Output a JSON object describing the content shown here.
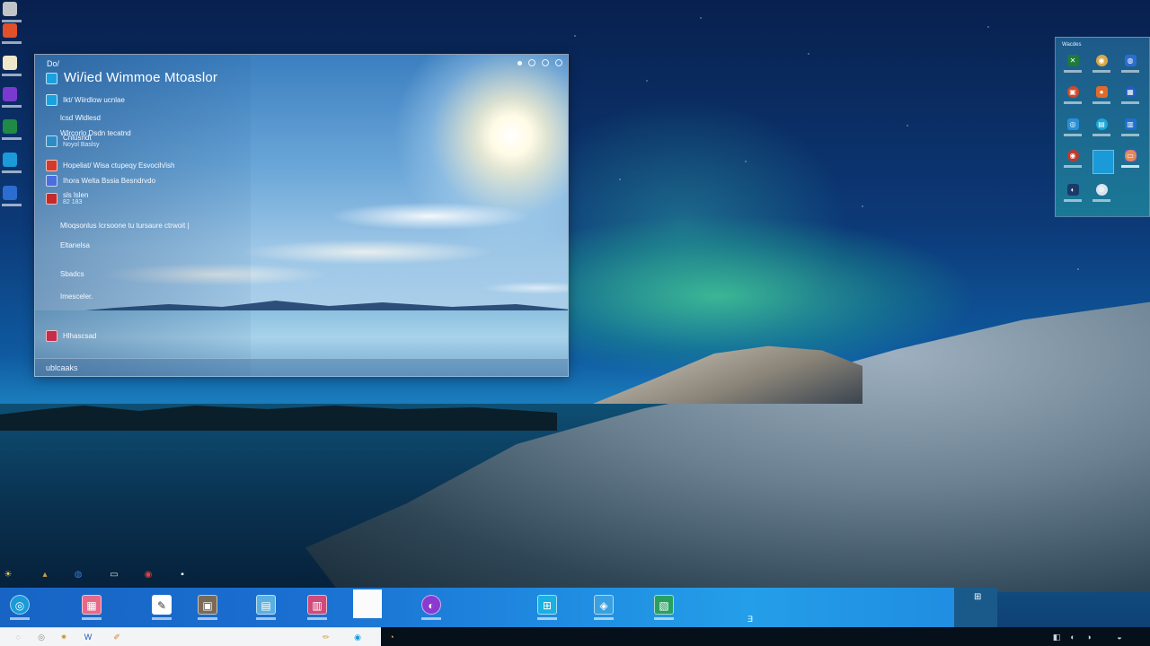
{
  "main_window": {
    "app_label": "Do/",
    "title": "Wi/ied Wimmoe Mtoaslor",
    "rows": [
      {
        "text": "Ikt/ Wiirdlow ucnlae",
        "sub": "",
        "icon": "app-icon",
        "color": "#1aa1e0"
      },
      {
        "text": "lcsd Wldlesd",
        "sub": "",
        "icon": "",
        "color": ""
      },
      {
        "text": "Wlrcorlo Dsdn tecatnd",
        "sub": "",
        "icon": "",
        "color": ""
      },
      {
        "text": "Cnlusndt",
        "sub": "Noyol Baslsy",
        "icon": "app-icon",
        "color": "#2b8cc7"
      },
      {
        "text": "Hopeliat/ Wisa ctupeqy Esvocih/ish",
        "sub": "",
        "icon": "",
        "color": "#d23b2b"
      },
      {
        "text": "Ihora Welta Bssia Besndrvdo",
        "sub": "",
        "icon": "",
        "color": "#4a6de0"
      },
      {
        "text": "sls lslen",
        "sub": "82 183",
        "icon": "",
        "color": "#c42a2a"
      },
      {
        "text": "Mloqsonlus Icrsoone tu tursaure ctrwoit |",
        "sub": "",
        "icon": "",
        "color": ""
      },
      {
        "text": "Eltanelsa",
        "sub": "",
        "icon": "",
        "color": ""
      },
      {
        "text": "Sbadcs",
        "sub": "",
        "icon": "",
        "color": ""
      },
      {
        "text": "Imesceler.",
        "sub": "",
        "icon": "",
        "color": ""
      },
      {
        "text": "Hlhascsad",
        "sub": "",
        "icon": "",
        "color": "#c72c48"
      }
    ],
    "status": "ublcaaks"
  },
  "tile_panel": {
    "title": "Wacdes",
    "tiles": [
      {
        "name": "xbox-icon",
        "color": "#1f7a3a",
        "glyph": "✕"
      },
      {
        "name": "photos-icon",
        "color": "#d9a84a",
        "glyph": "◉"
      },
      {
        "name": "globe-icon",
        "color": "#2b6dd0",
        "glyph": "◍"
      },
      {
        "name": "office-icon",
        "color": "#d04a2a",
        "glyph": "▣"
      },
      {
        "name": "orange-app-icon",
        "color": "#e06a2a",
        "glyph": "●"
      },
      {
        "name": "blue-app-icon",
        "color": "#1e5fc0",
        "glyph": "▦"
      },
      {
        "name": "edge-icon",
        "color": "#2a8fd8",
        "glyph": "◎"
      },
      {
        "name": "store-icon",
        "color": "#1aa7d8",
        "glyph": "▤"
      },
      {
        "name": "book-icon",
        "color": "#1f6fd0",
        "glyph": "▥"
      },
      {
        "name": "chrome-icon",
        "color": "#c0392b",
        "glyph": "◉"
      },
      {
        "name": "purple-app-icon",
        "color": "#8a4ed8",
        "glyph": "⊡"
      },
      {
        "name": "folder-icon",
        "color": "#e08a5a",
        "glyph": "▭"
      },
      {
        "name": "steam-icon",
        "color": "#1a3a6a",
        "glyph": "◐"
      },
      {
        "name": "settings-icon",
        "color": "#d8e4ee",
        "glyph": "⚙"
      }
    ]
  },
  "taskbar": {
    "items": [
      {
        "name": "start-icon",
        "color": "#1a9ad8",
        "glyph": "◎"
      },
      {
        "name": "gallery-icon",
        "color": "#e56a8a",
        "glyph": "▦"
      },
      {
        "name": "pen-icon",
        "color": "#ffffff",
        "glyph": "✎"
      },
      {
        "name": "photo-app-icon",
        "color": "#7a6a5a",
        "glyph": "▣"
      },
      {
        "name": "mail-icon",
        "color": "#5ab0e0",
        "glyph": "▤"
      },
      {
        "name": "calendar-icon",
        "color": "#d04a7a",
        "glyph": "▥"
      },
      {
        "name": "onenote-icon",
        "color": "#8a3ad0",
        "glyph": "◐"
      },
      {
        "name": "windows-icon",
        "color": "#1ab0e0",
        "glyph": "⊞"
      },
      {
        "name": "security-icon",
        "color": "#3aa0e0",
        "glyph": "◈"
      },
      {
        "name": "store-taskbar-icon",
        "color": "#2aa060",
        "glyph": "▧"
      }
    ],
    "tray_text": "Ǝ",
    "tray_right": "⊞"
  },
  "bottom_strip": {
    "icons": [
      {
        "name": "circle-icon",
        "glyph": "◌",
        "color": "#888888"
      },
      {
        "name": "target-icon",
        "glyph": "◎",
        "color": "#888888"
      },
      {
        "name": "gear-icon",
        "glyph": "✷",
        "color": "#c09030"
      },
      {
        "name": "word-icon",
        "glyph": "W",
        "color": "#1a5fc0"
      },
      {
        "name": "brush-icon",
        "glyph": "✐",
        "color": "#d08030"
      },
      {
        "name": "pencil-icon",
        "glyph": "✏",
        "color": "#d0a040"
      },
      {
        "name": "skype-icon",
        "glyph": "◉",
        "color": "#1a9ad8"
      },
      {
        "name": "clock-icon",
        "glyph": "◔",
        "color": "#e0b060"
      }
    ],
    "tray": [
      {
        "name": "network-icon",
        "glyph": "◧"
      },
      {
        "name": "volume-icon",
        "glyph": "◐"
      },
      {
        "name": "battery-icon",
        "glyph": "◑"
      },
      {
        "name": "notification-icon",
        "glyph": "◒"
      }
    ]
  },
  "desktop": {
    "left_icons": [
      {
        "name": "recycle-icon",
        "color": "#c0c4c8"
      },
      {
        "name": "office-desktop-icon",
        "color": "#e0502a"
      },
      {
        "name": "notes-desktop-icon",
        "color": "#f0e8c8"
      },
      {
        "name": "onenote-desktop-icon",
        "color": "#7a3ad0"
      },
      {
        "name": "excel-desktop-icon",
        "color": "#1f8a45"
      },
      {
        "name": "edge-desktop-icon",
        "color": "#1a9ad8"
      },
      {
        "name": "browser-desktop-icon",
        "color": "#2b6dd0"
      }
    ],
    "bottom_icons": [
      {
        "name": "sun-icon",
        "glyph": "☀",
        "color": "#f0d060"
      },
      {
        "name": "hat-icon",
        "glyph": "▴",
        "color": "#d0a040"
      },
      {
        "name": "globe-desktop-icon",
        "glyph": "◍",
        "color": "#3a7ad8"
      },
      {
        "name": "folder-desktop-icon",
        "glyph": "▭",
        "color": "#e0e0d0"
      },
      {
        "name": "record-icon",
        "glyph": "◉",
        "color": "#e04040"
      },
      {
        "name": "terminal-icon",
        "glyph": "▪",
        "color": "#ffffff"
      }
    ]
  }
}
